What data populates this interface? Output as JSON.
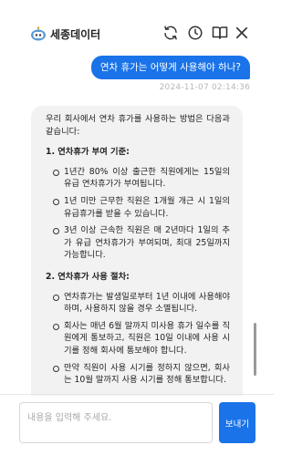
{
  "header": {
    "brand_name": "세종데이터",
    "icons": [
      "robot-logo-icon",
      "refresh-icon",
      "history-clock-icon",
      "book-icon",
      "close-icon"
    ]
  },
  "chat": {
    "user_message": "연차 휴가는 어떻게 사용해야 하나?",
    "timestamp": "2024-11-07 02:14:36",
    "bot_intro": "우리 회사에서 연차 휴가를 사용하는 방법은 다음과 같습니다:",
    "sections": [
      {
        "title": "1. 연차휴가 부여 기준:",
        "items": [
          "1년간 80% 이상 출근한 직원에게는 15일의 유급 연차휴가가 부여됩니다.",
          "1년 미만 근무한 직원은 1개월 개근 시 1일의 유급휴가를 받을 수 있습니다.",
          "3년 이상 근속한 직원은 매 2년마다 1일의 추가 유급 연차휴가가 부여되며, 최대 25일까지 가능합니다."
        ]
      },
      {
        "title": "2. 연차휴가 사용 절차:",
        "items": [
          "연차휴가는 발생일로부터 1년 이내에 사용해야 하며, 사용하지 않을 경우 소멸됩니다.",
          "회사는 매년 6월 말까지 미사용 휴가 일수를 직원에게 통보하고, 직원은 10일 이내에 사용 시기를 정해 회사에 통보해야 합니다.",
          "만약 직원이 사용 시기를 정하지 않으면, 회사는 10월 말까지 사용 시기를 정해 통보합니다."
        ]
      }
    ]
  },
  "composer": {
    "placeholder": "내용을 입력해 주세요.",
    "value": "",
    "send_label": "보내기"
  },
  "colors": {
    "accent": "#1a73e8",
    "bot_bubble_bg": "#f2f2f2",
    "timestamp": "#b8b8b8"
  }
}
